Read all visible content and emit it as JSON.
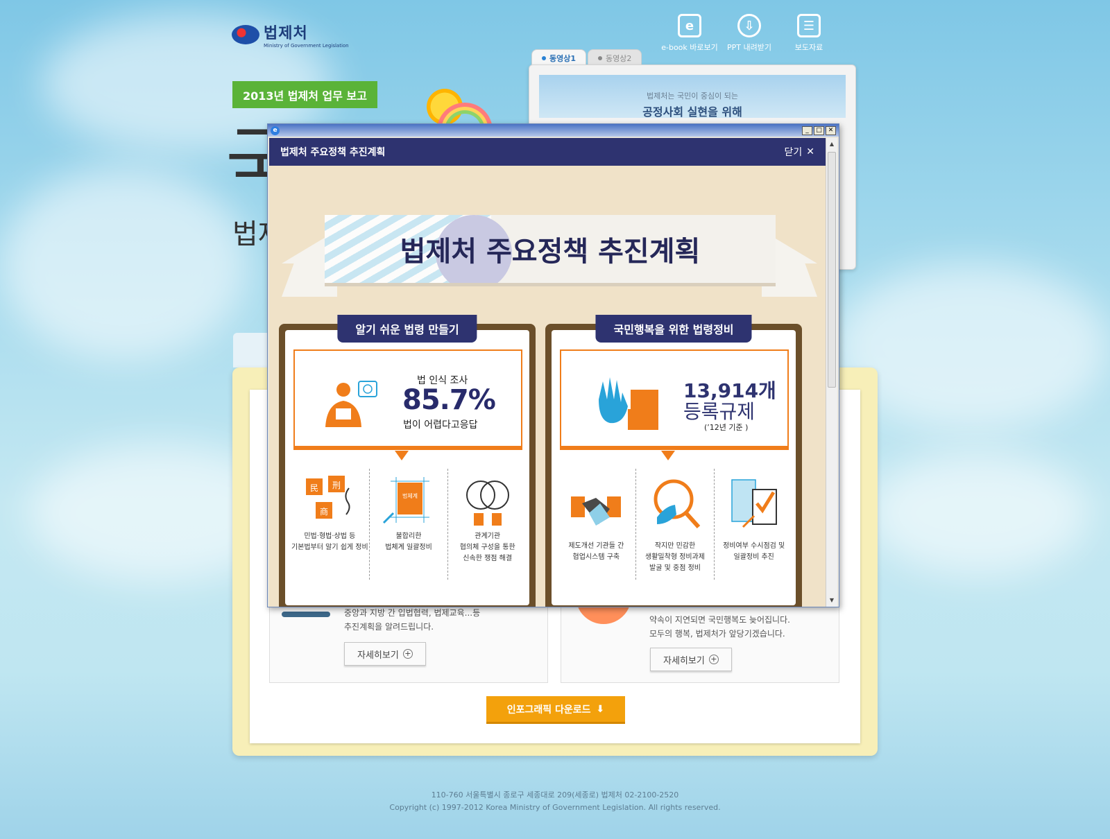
{
  "header": {
    "logo_title": "법제처",
    "logo_sub": "Ministry of Government Legislation",
    "tools": [
      {
        "icon": "ebook-icon",
        "glyph": "e",
        "label": "e-book 바로보기"
      },
      {
        "icon": "download-icon",
        "glyph": "⇩",
        "label": "PPT 내려받기"
      },
      {
        "icon": "clipboard-icon",
        "glyph": "☰",
        "label": "보도자료"
      }
    ]
  },
  "hero": {
    "badge": "2013년 법제처 업무 보고",
    "big_char": "국",
    "small_char": "법제"
  },
  "video": {
    "tabs": [
      "동영상1",
      "동영상2"
    ],
    "line1": "법제처는 국민이 중심이 되는",
    "line2": "공정사회 실현을 위해"
  },
  "background_cards": {
    "left_text": [
      "중앙과 지방 간 입법협력, 법제교육...등",
      "추진계획을 알려드립니다."
    ],
    "right_text": [
      "약속이 지연되면 국민행복도 늦어집니다.",
      "모두의 행복, 법제처가 앞당기겠습니다."
    ],
    "more_label": "자세히보기",
    "download_label": "인포그래픽 다운로드"
  },
  "footer": {
    "address": "110-760 서울특별시 종로구 세종대로 209(세종로) 법제처 02-2100-2520",
    "copyright": "Copyright (c) 1997-2012 Korea Ministry of Government Legislation. All rights reserved."
  },
  "popup": {
    "title": "법제처 주요정책 추진계획",
    "close_label": "닫기",
    "ribbon_title": "법제처 주요정책 추진계획",
    "left_panel": {
      "tag": "알기 쉬운 법령 만들기",
      "stat_top": "법 인식 조사",
      "stat_value": "85.7%",
      "stat_bottom": "법이 어렵다고응답",
      "features": [
        {
          "icon": "law-codes-icon",
          "lines": [
            "민법·형법·상법 등",
            "기본법부터 알기 쉽게 정비"
          ]
        },
        {
          "icon": "law-system-book-icon",
          "lines": [
            "불합리한",
            "법체계 일괄정비"
          ]
        },
        {
          "icon": "agency-cooperation-icon",
          "lines": [
            "관계기관",
            "협의체 구성을 통한",
            "신속한 쟁점 해결"
          ]
        }
      ],
      "book_label": "법체계",
      "chars": [
        "民",
        "刑",
        "商"
      ]
    },
    "right_panel": {
      "tag": "국민행복을 위한 법령정비",
      "stat_value": "13,914개",
      "stat_label": "등록규제",
      "stat_note": "(’12년 기준 )",
      "features": [
        {
          "icon": "handshake-icon",
          "lines": [
            "제도개선 기관들 간",
            "협업시스템 구축"
          ]
        },
        {
          "icon": "magnifier-icon",
          "lines": [
            "작지만 민감한",
            "생활밀착형 정비과제",
            "발굴 및 중점 정비"
          ]
        },
        {
          "icon": "checklist-icon",
          "lines": [
            "정비여부 수시점검 및",
            "일괄정비 추진"
          ]
        }
      ]
    }
  },
  "colors": {
    "navy": "#2e3370",
    "orange": "#f07d1a",
    "green_badge": "#5ab338",
    "brown_frame": "#6b4f2a"
  }
}
